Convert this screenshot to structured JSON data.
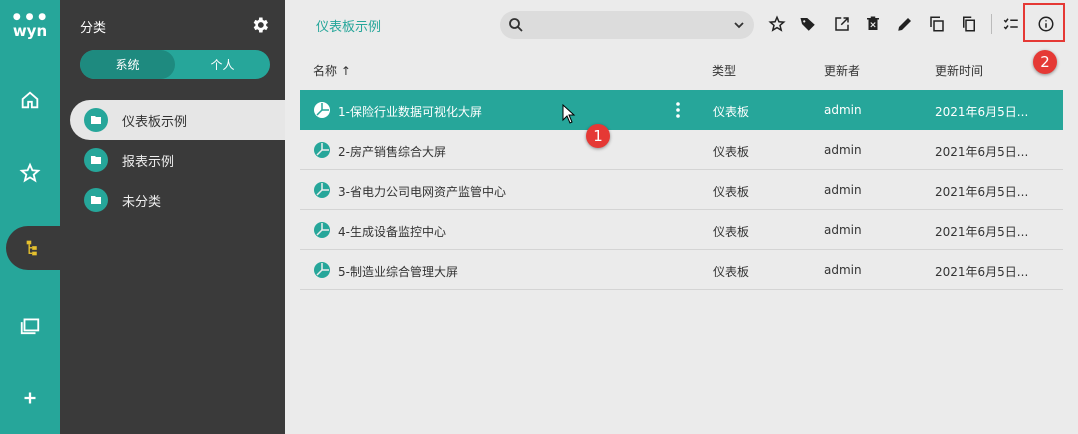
{
  "app": {
    "logo_text": "wyn"
  },
  "rail": {
    "items": [
      {
        "name": "home",
        "icon": "home-icon"
      },
      {
        "name": "favorites",
        "icon": "star-icon"
      },
      {
        "name": "categories",
        "icon": "tree-icon",
        "active": true
      },
      {
        "name": "documents",
        "icon": "folders-icon"
      },
      {
        "name": "create",
        "icon": "plus-icon"
      }
    ]
  },
  "category_panel": {
    "title": "分类",
    "tabs": {
      "system": "系统",
      "personal": "个人"
    },
    "items": [
      {
        "label": "仪表板示例",
        "active": true
      },
      {
        "label": "报表示例"
      },
      {
        "label": "未分类"
      }
    ]
  },
  "main": {
    "breadcrumb": "仪表板示例",
    "search": {
      "value": "",
      "placeholder": ""
    },
    "columns": {
      "name": "名称 ↑",
      "type": "类型",
      "updater": "更新者",
      "updated": "更新时间"
    },
    "rows": [
      {
        "name": "1-保险行业数据可视化大屏",
        "type": "仪表板",
        "updater": "admin",
        "updated": "2021年6月5日...",
        "selected": true
      },
      {
        "name": "2-房产销售综合大屏",
        "type": "仪表板",
        "updater": "admin",
        "updated": "2021年6月5日..."
      },
      {
        "name": "3-省电力公司电网资产监管中心",
        "type": "仪表板",
        "updater": "admin",
        "updated": "2021年6月5日..."
      },
      {
        "name": "4-生成设备监控中心",
        "type": "仪表板",
        "updater": "admin",
        "updated": "2021年6月5日..."
      },
      {
        "name": "5-制造业综合管理大屏",
        "type": "仪表板",
        "updater": "admin",
        "updated": "2021年6月5日..."
      }
    ]
  },
  "annotations": {
    "badge1": "1",
    "badge2": "2"
  },
  "colors": {
    "accent": "#26a69a",
    "dark_panel": "#3a3a3a",
    "highlight": "#e53935"
  }
}
